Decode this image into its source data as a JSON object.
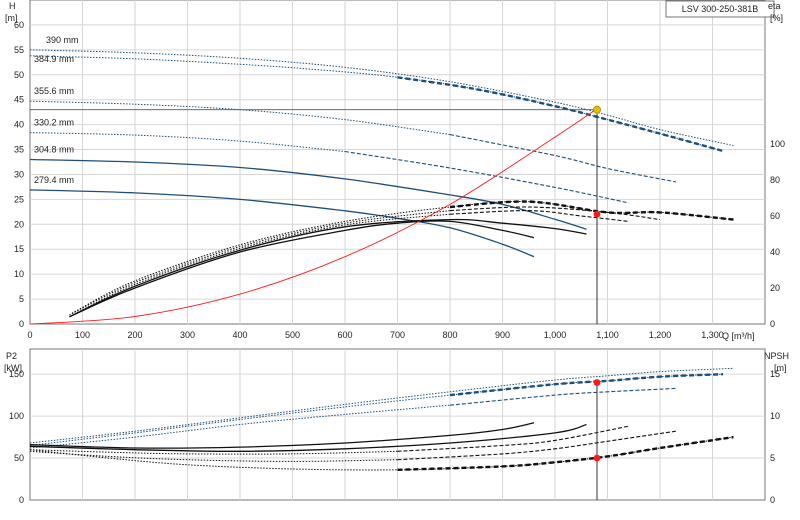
{
  "chart_data": [
    {
      "type": "line",
      "title": "LSV 300-250-381B",
      "ylabel_left_line1": "H",
      "ylabel_left_line2": "[m]",
      "ylabel_right_line1": "eta",
      "ylabel_right_line2": "[%]",
      "xlabel": "Q [m³/h]",
      "xlim": [
        0,
        1400
      ],
      "ylim": [
        0,
        65
      ],
      "ylim_right": [
        0,
        180
      ],
      "x_ticks": [
        0,
        100,
        200,
        300,
        400,
        500,
        600,
        700,
        800,
        900,
        1000,
        1100,
        1200,
        1300
      ],
      "x_tick_labels": [
        "0",
        "100",
        "200",
        "300",
        "400",
        "500",
        "600",
        "700",
        "800",
        "900",
        "1,000",
        "1,100",
        "1,200",
        "1,300"
      ],
      "y_ticks": [
        0,
        5,
        10,
        15,
        20,
        25,
        30,
        35,
        40,
        45,
        50,
        55,
        60
      ],
      "y_right_ticks": [
        0,
        20,
        40,
        60,
        80,
        100
      ],
      "grid": true,
      "curve_labels": [
        "390 mm",
        "384.9 mm",
        "355.6 mm",
        "330.2 mm",
        "304.8 mm",
        "279.4 mm"
      ],
      "series": [
        {
          "kind": "head",
          "x": [
            0,
            200,
            400,
            600,
            800,
            1000,
            1100,
            1200,
            1340
          ],
          "y": [
            55.0,
            54.4,
            53.3,
            51.5,
            48.6,
            44.5,
            41.9,
            39.0,
            35.8
          ],
          "color": "#1d4f7d",
          "dash": "dotted"
        },
        {
          "kind": "head",
          "x": [
            0,
            200,
            400,
            550,
            700,
            850,
            1000,
            1100,
            1200,
            1320
          ],
          "y": [
            53.8,
            53.2,
            52.1,
            51.0,
            49.5,
            47.1,
            43.7,
            41.0,
            38.2,
            34.7
          ],
          "color": "#1d4f7d",
          "dash": "bold"
        },
        {
          "kind": "head",
          "x": [
            0,
            200,
            400,
            600,
            800,
            1000,
            1100,
            1230
          ],
          "y": [
            44.7,
            44.1,
            43.0,
            41.0,
            38.0,
            33.8,
            31.2,
            28.5
          ],
          "color": "#1d4f7d",
          "dash": "partial"
        },
        {
          "kind": "head",
          "x": [
            0,
            200,
            400,
            600,
            800,
            1000,
            1140
          ],
          "y": [
            38.4,
            37.9,
            36.7,
            34.6,
            31.3,
            27.4,
            24.3
          ],
          "color": "#1d4f7d",
          "dash": "partial"
        },
        {
          "kind": "head",
          "x": [
            0,
            200,
            400,
            600,
            800,
            900,
            1000,
            1060
          ],
          "y": [
            33.0,
            32.5,
            31.4,
            29.1,
            25.9,
            24.0,
            21.0,
            19.0
          ],
          "color": "#1d4f7d",
          "dash": "solid"
        },
        {
          "kind": "head",
          "x": [
            0,
            200,
            400,
            600,
            700,
            800,
            900,
            960
          ],
          "y": [
            26.9,
            26.3,
            25.0,
            22.7,
            21.2,
            19.3,
            16.0,
            13.5
          ],
          "color": "#1d4f7d",
          "dash": "solid"
        },
        {
          "kind": "eta",
          "x": [
            80,
            200,
            400,
            600,
            800,
            950,
            1100,
            1200,
            1340
          ],
          "y": [
            6,
            24,
            44,
            57,
            65,
            68,
            62,
            62,
            58
          ],
          "color": "#111111",
          "dash": "bold"
        },
        {
          "kind": "eta",
          "x": [
            75,
            200,
            400,
            600,
            800,
            950,
            1100,
            1200
          ],
          "y": [
            5,
            23,
            43,
            56,
            63,
            65,
            62,
            58
          ],
          "color": "#111111",
          "dash": "partial"
        },
        {
          "kind": "eta",
          "x": [
            75,
            200,
            400,
            600,
            800,
            950,
            1050,
            1140
          ],
          "y": [
            4,
            22,
            42,
            55,
            61,
            63,
            60,
            57
          ],
          "color": "#111111",
          "dash": "partial"
        },
        {
          "kind": "eta",
          "x": [
            75,
            200,
            400,
            600,
            800,
            900,
            1000,
            1060
          ],
          "y": [
            4,
            21,
            41,
            54,
            58,
            56,
            53,
            50
          ],
          "color": "#111111",
          "dash": "solid"
        },
        {
          "kind": "eta",
          "x": [
            75,
            200,
            400,
            600,
            700,
            800,
            900,
            960
          ],
          "y": [
            4,
            20,
            40,
            52,
            56,
            57,
            52,
            48
          ],
          "color": "#111111",
          "dash": "solid"
        },
        {
          "kind": "system",
          "x": [
            0,
            200,
            400,
            600,
            800,
            1000,
            1080
          ],
          "y": [
            0,
            1.5,
            6.0,
            13.5,
            24.0,
            37.5,
            43.2
          ],
          "color": "#ff1a1a",
          "dash": "solid"
        }
      ],
      "duty_point": {
        "x": 1080,
        "y": 43.0,
        "color": "#e0c000"
      },
      "eta_point": {
        "x": 1080,
        "y": 61
      }
    },
    {
      "type": "line",
      "ylabel_left_line1": "P2",
      "ylabel_left_line2": "[kW]",
      "ylabel_right_line1": "NPSH",
      "ylabel_right_line2": "[m]",
      "xlim": [
        0,
        1400
      ],
      "ylim": [
        0,
        180
      ],
      "ylim_right": [
        0,
        18
      ],
      "y_ticks": [
        0,
        50,
        100,
        150
      ],
      "y_right_ticks": [
        0,
        5,
        10,
        15
      ],
      "grid": true,
      "series": [
        {
          "kind": "npsh",
          "x": [
            0,
            200,
            400,
            600,
            800,
            1000,
            1100,
            1200,
            1340
          ],
          "y": [
            6.8,
            8.2,
            9.8,
            11.4,
            12.9,
            14.3,
            14.8,
            15.3,
            15.7
          ],
          "color": "#1d4f7d",
          "dash": "dotted"
        },
        {
          "kind": "npsh",
          "x": [
            0,
            200,
            400,
            600,
            800,
            1000,
            1100,
            1200,
            1320
          ],
          "y": [
            6.5,
            8.0,
            9.6,
            11.1,
            12.5,
            13.8,
            14.2,
            14.7,
            15.0
          ],
          "color": "#1d4f7d",
          "dash": "bold"
        },
        {
          "kind": "npsh",
          "x": [
            0,
            200,
            400,
            600,
            800,
            1000,
            1100,
            1230
          ],
          "y": [
            6.2,
            7.5,
            9.0,
            10.2,
            11.3,
            12.5,
            12.9,
            13.3
          ],
          "color": "#1d4f7d",
          "dash": "partial"
        },
        {
          "kind": "power",
          "x": [
            0,
            150,
            300,
            500,
            700,
            900,
            1000,
            1100,
            1200,
            1340
          ],
          "y": [
            60,
            50,
            42,
            37,
            36,
            40,
            45,
            52,
            62,
            75
          ],
          "color": "#111111",
          "dash": "bold"
        },
        {
          "kind": "power",
          "x": [
            0,
            150,
            300,
            500,
            700,
            900,
            1000,
            1100,
            1230
          ],
          "y": [
            58,
            52,
            48,
            46,
            48,
            55,
            61,
            70,
            82
          ],
          "color": "#111111",
          "dash": "partial"
        },
        {
          "kind": "power",
          "x": [
            0,
            150,
            300,
            500,
            700,
            900,
            1000,
            1140
          ],
          "y": [
            60,
            57,
            55,
            55,
            58,
            65,
            71,
            88
          ],
          "color": "#111111",
          "dash": "partial"
        },
        {
          "kind": "power",
          "x": [
            0,
            200,
            400,
            600,
            800,
            1000,
            1060
          ],
          "y": [
            64,
            60,
            58,
            61,
            68,
            80,
            90
          ],
          "color": "#111111",
          "dash": "solid"
        },
        {
          "kind": "power",
          "x": [
            0,
            200,
            400,
            600,
            800,
            900,
            960
          ],
          "y": [
            66,
            62,
            63,
            68,
            77,
            84,
            92
          ],
          "color": "#111111",
          "dash": "solid"
        }
      ],
      "npsh_point": {
        "x": 1080,
        "y": 14.0
      },
      "power_point": {
        "x": 1080,
        "y": 50
      }
    }
  ]
}
